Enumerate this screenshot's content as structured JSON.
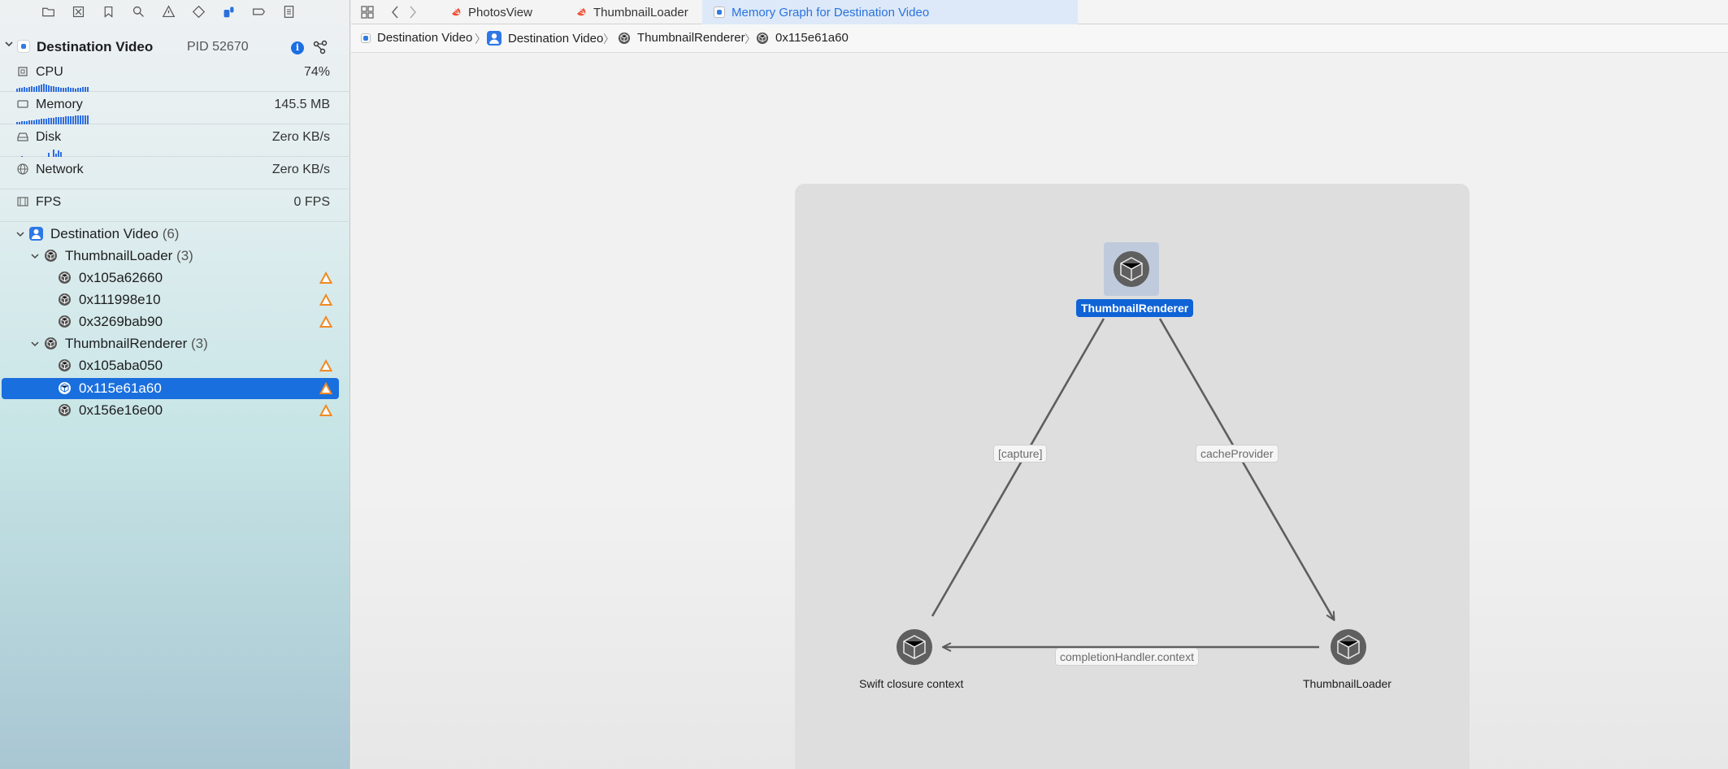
{
  "sidebar": {
    "process": {
      "name": "Destination Video",
      "pid": "PID 52670"
    },
    "gauges": [
      {
        "label": "CPU",
        "value": "74%"
      },
      {
        "label": "Memory",
        "value": "145.5 MB"
      },
      {
        "label": "Disk",
        "value": "Zero KB/s"
      },
      {
        "label": "Network",
        "value": "Zero KB/s"
      },
      {
        "label": "FPS",
        "value": "0 FPS"
      }
    ],
    "tree": {
      "root": {
        "label": "Destination Video",
        "count": "(6)"
      },
      "groups": [
        {
          "label": "ThumbnailLoader",
          "count": "(3)",
          "items": [
            "0x105a62660",
            "0x111998e10",
            "0x3269bab90"
          ]
        },
        {
          "label": "ThumbnailRenderer",
          "count": "(3)",
          "items": [
            "0x105aba050",
            "0x115e61a60",
            "0x156e16e00"
          ]
        }
      ],
      "selected_item": "0x115e61a60"
    }
  },
  "tabs": [
    {
      "label": "PhotosView",
      "active": false
    },
    {
      "label": "ThumbnailLoader",
      "active": false
    },
    {
      "label": "Memory Graph for Destination Video",
      "active": true
    }
  ],
  "breadcrumb": [
    "Destination Video",
    "Destination Video",
    "ThumbnailRenderer",
    "0x115e61a60"
  ],
  "graph": {
    "nodes": {
      "top": "ThumbnailRenderer",
      "bottom_left": "Swift closure context",
      "bottom_right": "ThumbnailLoader"
    },
    "edges": {
      "left": "[capture]",
      "right": "cacheProvider",
      "bottom": "completionHandler.context"
    }
  },
  "colors": {
    "accent": "#1a6fde",
    "warning": "#f08a24",
    "selected_node_label": "#0f63d6"
  }
}
